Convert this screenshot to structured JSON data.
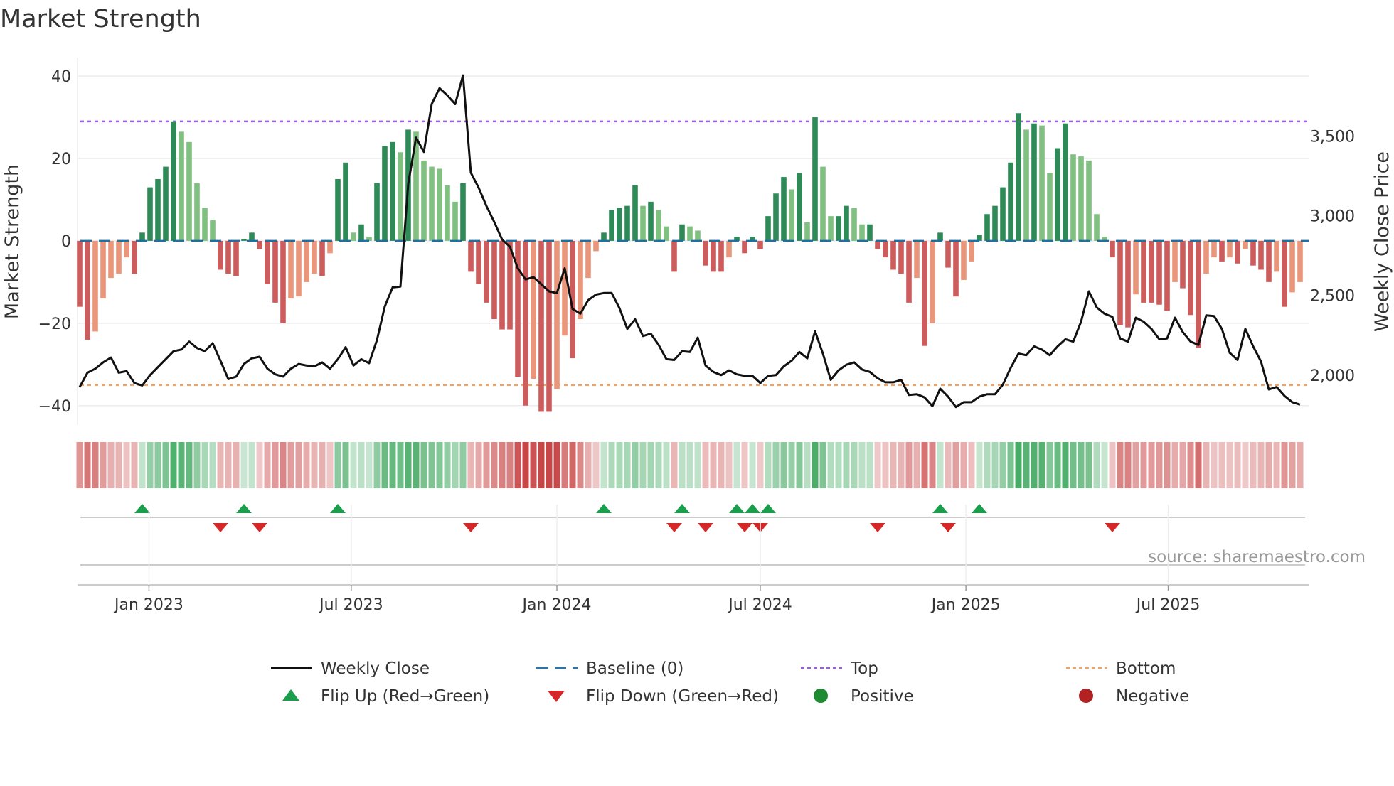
{
  "chart_data": {
    "type": "bar",
    "title": "Market Strength",
    "ylabel": "Market Strength",
    "y2label": "Weekly Close Price",
    "ylim": [
      -44.7,
      44.5
    ],
    "y2lim": [
      1687,
      3992
    ],
    "yticks": [
      40,
      20,
      0,
      -20,
      -40
    ],
    "ytick_labels": [
      "40",
      "20",
      "0",
      "−20",
      "−40"
    ],
    "y2ticks": [
      3500,
      3000,
      2500,
      2000
    ],
    "y2tick_labels": [
      "3,500",
      "3,000",
      "2,500",
      "2,000"
    ],
    "start_date": "2022-10-31",
    "frequency": "weekly",
    "xticks": [
      {
        "date": "2023-01-01",
        "label": "Jan 2023"
      },
      {
        "date": "2023-07-01",
        "label": "Jul 2023"
      },
      {
        "date": "2024-01-01",
        "label": "Jan 2024"
      },
      {
        "date": "2024-07-01",
        "label": "Jul 2024"
      },
      {
        "date": "2025-01-01",
        "label": "Jan 2025"
      },
      {
        "date": "2025-07-01",
        "label": "Jul 2025"
      }
    ],
    "top_level": 29,
    "bottom_level": -35,
    "baseline": 0,
    "strength": [
      -16,
      -24,
      -22,
      -14,
      -9,
      -8,
      -4,
      -8,
      2,
      13,
      15,
      18,
      29,
      26.5,
      24,
      14,
      8,
      5,
      -7,
      -8,
      -8.5,
      0.5,
      2,
      -2,
      -10.5,
      -15,
      -20,
      -14,
      -13.5,
      -10,
      -8,
      -8.5,
      -3,
      15,
      19,
      2,
      4,
      1,
      14,
      23,
      24,
      21.5,
      27,
      26.5,
      19.5,
      18,
      17.5,
      13.5,
      9.5,
      14,
      -7.5,
      -10.5,
      -15,
      -19,
      -21.5,
      -21.5,
      -33,
      -40,
      -33.5,
      -41.5,
      -41.5,
      -36,
      -23,
      -28.5,
      -19,
      -9,
      -2.5,
      2,
      7.5,
      8,
      8.5,
      13.5,
      8.5,
      9.5,
      7.5,
      3.5,
      -7.5,
      4,
      3.5,
      2.5,
      -6,
      -7.5,
      -7.5,
      -4,
      1,
      -3,
      1,
      -2,
      6,
      11.5,
      15.5,
      12.5,
      16.5,
      4.5,
      30,
      18,
      6,
      6,
      8.5,
      8,
      4,
      4,
      -2,
      -4,
      -7,
      -8,
      -15,
      -9,
      -25.5,
      -20,
      2,
      -6.5,
      -13.5,
      -9.5,
      -5,
      1.5,
      6.5,
      8.5,
      13,
      19,
      31,
      27,
      28.5,
      28,
      16.5,
      22.5,
      28.5,
      21,
      20.5,
      19.5,
      6.5,
      1,
      -4,
      -20.5,
      -21,
      -13,
      -15,
      -15,
      -15.5,
      -17,
      -10,
      -11.5,
      -18,
      -26,
      -8,
      -4,
      -5,
      -4,
      -5.5,
      -2,
      -6,
      -7,
      -10,
      -7.5,
      -16,
      -12.5,
      -10
    ],
    "weekly_close": [
      1925,
      2015,
      2040,
      2080,
      2110,
      2015,
      2025,
      1950,
      1935,
      2000,
      2050,
      2100,
      2150,
      2160,
      2210,
      2170,
      2150,
      2200,
      2090,
      1975,
      1990,
      2070,
      2105,
      2115,
      2040,
      2005,
      1990,
      2040,
      2070,
      2060,
      2055,
      2080,
      2040,
      2100,
      2175,
      2060,
      2100,
      2075,
      2220,
      2430,
      2550,
      2555,
      3200,
      3490,
      3400,
      3700,
      3800,
      3755,
      3700,
      3880,
      3270,
      3175,
      3060,
      2960,
      2850,
      2805,
      2670,
      2600,
      2615,
      2570,
      2525,
      2515,
      2670,
      2415,
      2385,
      2470,
      2505,
      2515,
      2515,
      2420,
      2290,
      2350,
      2245,
      2260,
      2190,
      2100,
      2095,
      2150,
      2145,
      2235,
      2060,
      2020,
      2000,
      2030,
      2005,
      1995,
      1995,
      1950,
      1995,
      2000,
      2055,
      2090,
      2145,
      2105,
      2275,
      2135,
      1970,
      2030,
      2065,
      2080,
      2035,
      2020,
      1980,
      1955,
      1955,
      1970,
      1875,
      1880,
      1860,
      1805,
      1915,
      1865,
      1800,
      1830,
      1830,
      1865,
      1880,
      1880,
      1940,
      2045,
      2135,
      2125,
      2180,
      2160,
      2125,
      2180,
      2225,
      2210,
      2335,
      2525,
      2425,
      2385,
      2365,
      2230,
      2210,
      2360,
      2335,
      2290,
      2225,
      2230,
      2360,
      2270,
      2210,
      2190,
      2375,
      2370,
      2290,
      2140,
      2095,
      2290,
      2180,
      2085,
      1910,
      1925,
      1870,
      1830,
      1815
    ],
    "flip_up_weeks": [
      8,
      21,
      33,
      67,
      77,
      84,
      86,
      88,
      110,
      115
    ],
    "flip_down_weeks": [
      18,
      23,
      50,
      76,
      80,
      85,
      87,
      102,
      111,
      132
    ],
    "legend": [
      {
        "label": "Weekly Close",
        "kind": "line",
        "color": "#111111"
      },
      {
        "label": "Baseline (0)",
        "kind": "dash",
        "color": "#1f77b4"
      },
      {
        "label": "Top",
        "kind": "dot",
        "color": "#9b5de5"
      },
      {
        "label": "Bottom",
        "kind": "dot",
        "color": "#f4a261"
      },
      {
        "label": "Flip Up (Red→Green)",
        "kind": "up",
        "color": "#1a9e4b"
      },
      {
        "label": "Flip Down (Green→Red)",
        "kind": "down",
        "color": "#d62728"
      },
      {
        "label": "Positive",
        "kind": "circle",
        "color": "#1e8a32"
      },
      {
        "label": "Negative",
        "kind": "circle",
        "color": "#b22222"
      }
    ],
    "legend_placement": "bottom",
    "colors": {
      "pos_rising": "#2e8b57",
      "pos_falling": "#80c080",
      "neg_falling": "#cd5c5c",
      "neg_rising": "#e9967a"
    }
  },
  "source": "source: sharemaestro.com"
}
